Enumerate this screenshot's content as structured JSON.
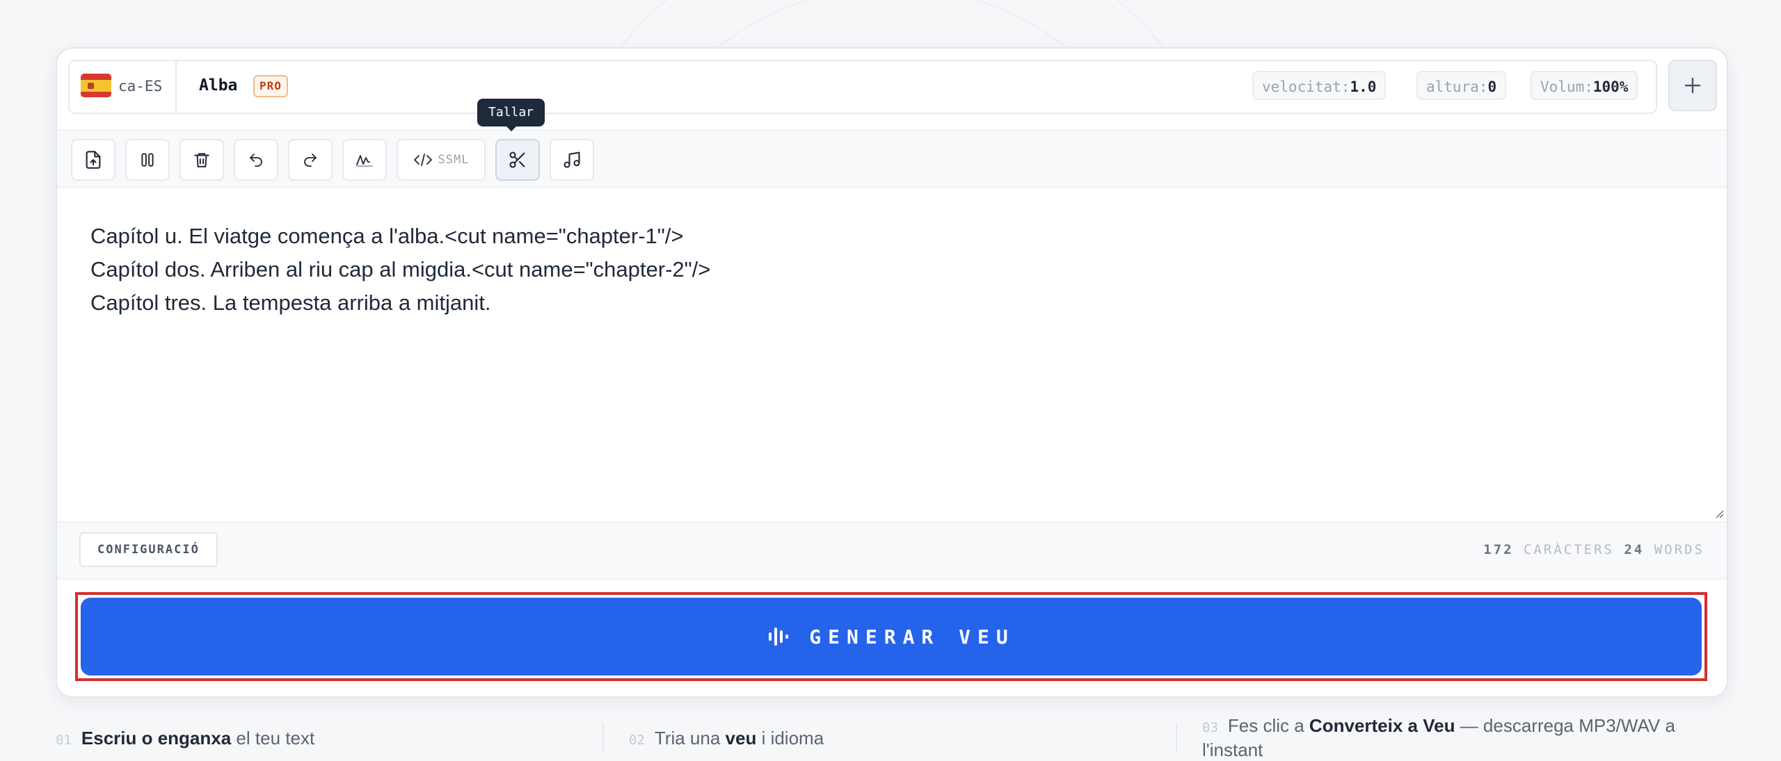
{
  "voice_bar": {
    "locale": "ca-ES",
    "flag_icon": "spain-flag-icon",
    "voice_name": "Alba",
    "badge": "PRO",
    "params": [
      {
        "key": "velocitat:",
        "value": "1.0"
      },
      {
        "key": "altura:",
        "value": "0"
      },
      {
        "key": "Volum:",
        "value": "100%"
      }
    ],
    "add_icon": "plus-icon"
  },
  "toolbar": {
    "tools": [
      {
        "name": "upload-icon"
      },
      {
        "name": "pause-icon"
      },
      {
        "name": "trash-icon"
      },
      {
        "name": "undo-icon"
      },
      {
        "name": "redo-icon"
      },
      {
        "name": "waveform-icon"
      },
      {
        "name": "code-icon",
        "label": "SSML"
      },
      {
        "name": "scissors-icon"
      },
      {
        "name": "music-note-icon"
      }
    ],
    "tooltip": "Tallar"
  },
  "editor": {
    "lines": [
      "Capítol u. El viatge comença a l'alba.<cut name=\"chapter-1\"/>",
      "Capítol dos. Arriben al riu cap al migdia.<cut name=\"chapter-2\"/>",
      "Capítol tres. La tempesta arriba a mitjanit."
    ]
  },
  "footer": {
    "config_label": "CONFIGURACIÓ",
    "char_count": "172",
    "char_label": "CARÀCTERS",
    "word_count": "24",
    "word_label": "WORDS"
  },
  "generate": {
    "label": "GENERAR VEU",
    "icon": "sound-wave-icon"
  },
  "steps": [
    {
      "num": "01",
      "bold": "Escriu o enganxa",
      "rest": " el teu text"
    },
    {
      "num": "02",
      "pre": "Tria una ",
      "bold": "veu",
      "rest": " i idioma"
    },
    {
      "num": "03",
      "pre": "Fes clic a ",
      "bold": "Converteix a Veu",
      "rest": " — descarrega MP3/WAV a l'instant"
    }
  ],
  "colors": {
    "accent": "#2563eb",
    "highlight": "#d32f2f",
    "badge": "#c2410c"
  }
}
